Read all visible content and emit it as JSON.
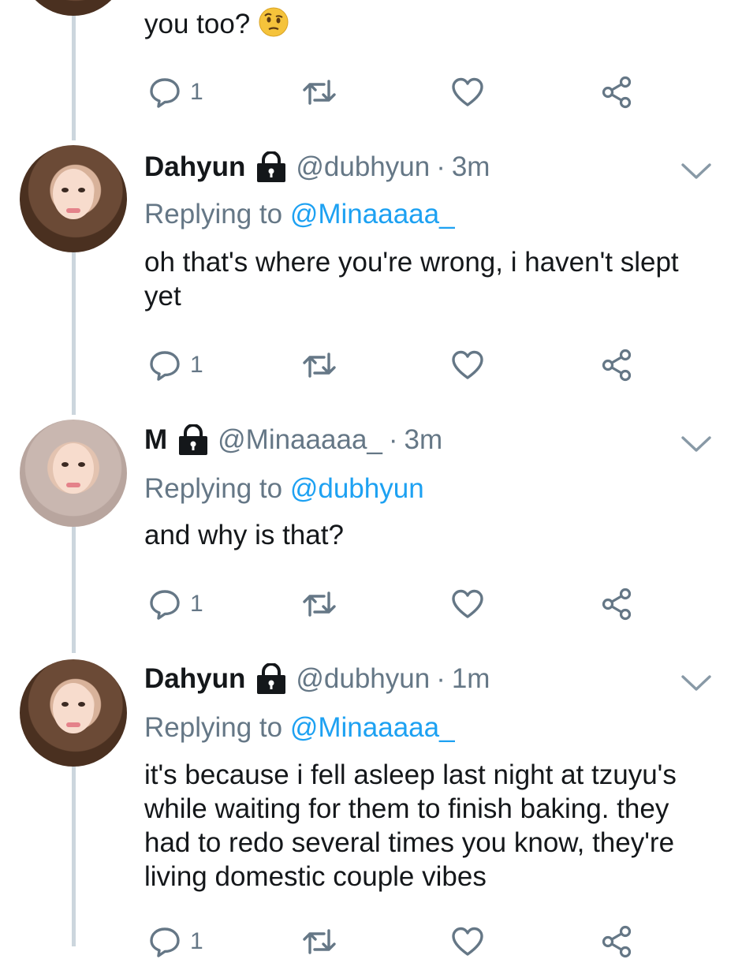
{
  "top_tweet": {
    "text": "you too?",
    "emoji": "face-with-raised-eyebrow",
    "reply_count": "1"
  },
  "tweets": [
    {
      "name": "Dahyun",
      "handle": "@dubhyun",
      "separator": "·",
      "time": "3m",
      "replying_prefix": "Replying to",
      "replying_to": "@Minaaaaa_",
      "text": "oh that's where you're wrong, i haven't slept yet",
      "reply_count": "1"
    },
    {
      "name": "M",
      "handle": "@Minaaaaa_",
      "separator": "·",
      "time": "3m",
      "replying_prefix": "Replying to",
      "replying_to": "@dubhyun",
      "text": "and why is that?",
      "reply_count": "1"
    },
    {
      "name": "Dahyun",
      "handle": "@dubhyun",
      "separator": "·",
      "time": "1m",
      "replying_prefix": "Replying to",
      "replying_to": "@Minaaaaa_",
      "text": "it's because i fell asleep last night at tzuyu's while waiting for them to finish baking. they had to redo several times you know, they're living domestic couple vibes",
      "reply_count": "1"
    }
  ],
  "icons": {
    "reply": "reply-icon",
    "retweet": "retweet-icon",
    "like": "heart-icon",
    "share": "share-icon",
    "lock": "lock-icon",
    "more": "chevron-down-icon"
  },
  "colors": {
    "text": "#14171a",
    "secondary": "#657786",
    "link": "#1da1f2",
    "thread_line": "#ccd6dd"
  }
}
